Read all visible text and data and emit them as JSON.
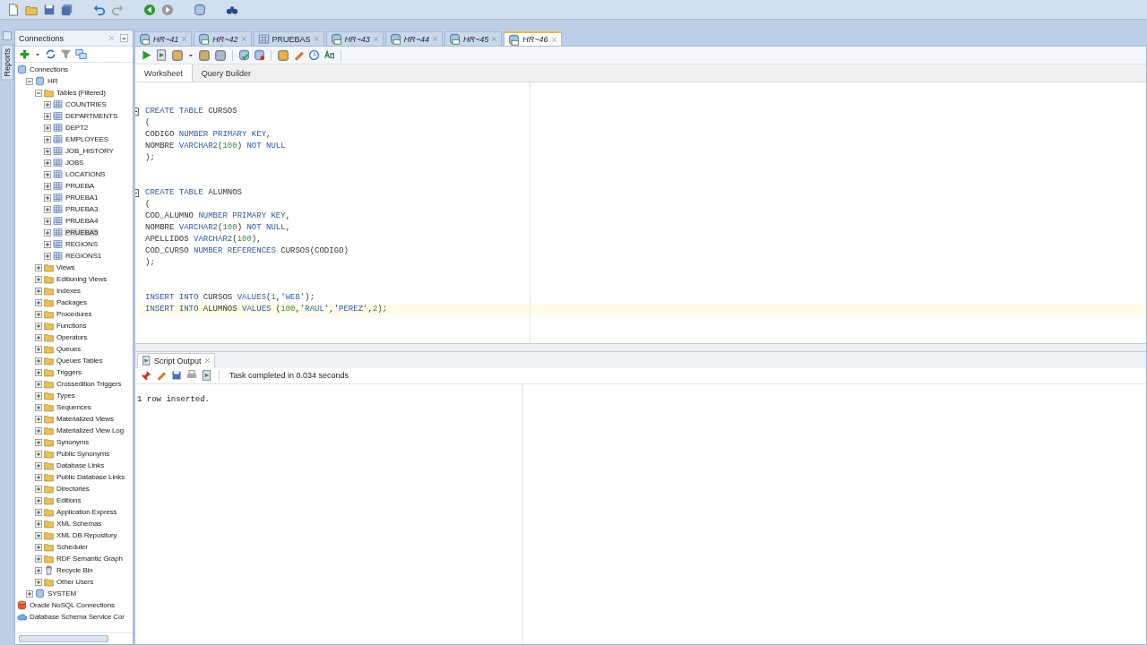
{
  "side_strip": {
    "label": "Reports"
  },
  "connections_panel": {
    "title": "Connections",
    "tree": [
      {
        "label": "Connections",
        "kind": "root",
        "selected": false,
        "children": [
          {
            "label": "HR",
            "kind": "connection",
            "expanded": true,
            "selected": false,
            "children": [
              {
                "label": "Tables (Filtered)",
                "kind": "folder",
                "expanded": true,
                "selected": false,
                "children": [
                  {
                    "label": "COUNTRIES",
                    "kind": "table",
                    "expanded": false,
                    "selected": false
                  },
                  {
                    "label": "DEPARTMENTS",
                    "kind": "table",
                    "expanded": false,
                    "selected": false
                  },
                  {
                    "label": "DEPT2",
                    "kind": "table",
                    "expanded": false,
                    "selected": false
                  },
                  {
                    "label": "EMPLOYEES",
                    "kind": "table",
                    "expanded": false,
                    "selected": false
                  },
                  {
                    "label": "JOB_HISTORY",
                    "kind": "table",
                    "expanded": false,
                    "selected": false
                  },
                  {
                    "label": "JOBS",
                    "kind": "table",
                    "expanded": false,
                    "selected": false
                  },
                  {
                    "label": "LOCATIONS",
                    "kind": "table",
                    "expanded": false,
                    "selected": false
                  },
                  {
                    "label": "PRUEBA",
                    "kind": "table",
                    "expanded": false,
                    "selected": false
                  },
                  {
                    "label": "PRUEBA1",
                    "kind": "table",
                    "expanded": false,
                    "selected": false
                  },
                  {
                    "label": "PRUEBA3",
                    "kind": "table",
                    "expanded": false,
                    "selected": false
                  },
                  {
                    "label": "PRUEBA4",
                    "kind": "table",
                    "expanded": false,
                    "selected": false
                  },
                  {
                    "label": "PRUEBA5",
                    "kind": "table",
                    "expanded": false,
                    "selected": true
                  },
                  {
                    "label": "REGIONS",
                    "kind": "table",
                    "expanded": false,
                    "selected": false
                  },
                  {
                    "label": "REGIONS1",
                    "kind": "table",
                    "expanded": false,
                    "selected": false
                  }
                ]
              },
              {
                "label": "Views",
                "kind": "folder",
                "expanded": false,
                "selected": false
              },
              {
                "label": "Editioning Views",
                "kind": "folder",
                "expanded": false,
                "selected": false
              },
              {
                "label": "Indexes",
                "kind": "folder",
                "expanded": false,
                "selected": false
              },
              {
                "label": "Packages",
                "kind": "folder",
                "expanded": false,
                "selected": false
              },
              {
                "label": "Procedures",
                "kind": "folder",
                "expanded": false,
                "selected": false
              },
              {
                "label": "Functions",
                "kind": "folder",
                "expanded": false,
                "selected": false
              },
              {
                "label": "Operators",
                "kind": "folder",
                "expanded": false,
                "selected": false
              },
              {
                "label": "Queues",
                "kind": "folder",
                "expanded": false,
                "selected": false
              },
              {
                "label": "Queues Tables",
                "kind": "folder",
                "expanded": false,
                "selected": false
              },
              {
                "label": "Triggers",
                "kind": "folder",
                "expanded": false,
                "selected": false
              },
              {
                "label": "Crossedition Triggers",
                "kind": "folder",
                "expanded": false,
                "selected": false
              },
              {
                "label": "Types",
                "kind": "folder",
                "expanded": false,
                "selected": false
              },
              {
                "label": "Sequences",
                "kind": "folder",
                "expanded": false,
                "selected": false
              },
              {
                "label": "Materialized Views",
                "kind": "folder",
                "expanded": false,
                "selected": false
              },
              {
                "label": "Materialized View Log",
                "kind": "folder",
                "expanded": false,
                "selected": false
              },
              {
                "label": "Synonyms",
                "kind": "folder",
                "expanded": false,
                "selected": false
              },
              {
                "label": "Public Synonyms",
                "kind": "folder",
                "expanded": false,
                "selected": false
              },
              {
                "label": "Database Links",
                "kind": "folder",
                "expanded": false,
                "selected": false
              },
              {
                "label": "Public Database Links",
                "kind": "folder",
                "expanded": false,
                "selected": false
              },
              {
                "label": "Directories",
                "kind": "folder",
                "expanded": false,
                "selected": false
              },
              {
                "label": "Editions",
                "kind": "folder",
                "expanded": false,
                "selected": false
              },
              {
                "label": "Application Express",
                "kind": "folder",
                "expanded": false,
                "selected": false
              },
              {
                "label": "XML Schemas",
                "kind": "folder",
                "expanded": false,
                "selected": false
              },
              {
                "label": "XML DB Repository",
                "kind": "folder",
                "expanded": false,
                "selected": false
              },
              {
                "label": "Scheduler",
                "kind": "folder",
                "expanded": false,
                "selected": false
              },
              {
                "label": "RDF Semantic Graph",
                "kind": "folder",
                "expanded": false,
                "selected": false
              },
              {
                "label": "Recycle Bin",
                "kind": "bin",
                "expanded": false,
                "selected": false
              },
              {
                "label": "Other Users",
                "kind": "folder",
                "expanded": false,
                "selected": false
              }
            ]
          },
          {
            "label": "SYSTEM",
            "kind": "connection",
            "expanded": false,
            "selected": false
          }
        ]
      },
      {
        "label": "Oracle NoSQL Connections",
        "kind": "nosql",
        "selected": false
      },
      {
        "label": "Database Schema Service Cor",
        "kind": "cloud",
        "selected": false
      }
    ]
  },
  "editor_tabs": [
    {
      "label": "HR~41",
      "kind": "worksheet",
      "selected": false
    },
    {
      "label": "HR~42",
      "kind": "worksheet",
      "selected": false
    },
    {
      "label": "PRUEBAS",
      "kind": "table",
      "selected": false
    },
    {
      "label": "HR~43",
      "kind": "worksheet",
      "selected": false
    },
    {
      "label": "HR~44",
      "kind": "worksheet",
      "selected": false
    },
    {
      "label": "HR~45",
      "kind": "worksheet",
      "selected": false
    },
    {
      "label": "HR~46",
      "kind": "worksheet",
      "selected": true
    }
  ],
  "sub_tabs": [
    {
      "label": "Worksheet",
      "selected": true
    },
    {
      "label": "Query Builder",
      "selected": false
    }
  ],
  "editor": {
    "lines": [
      {
        "kind": "code",
        "foldable": true,
        "current": false,
        "tokens": [
          {
            "text": "CREATE TABLE ",
            "kind": "keyword"
          },
          {
            "text": "CURSOS",
            "kind": "name"
          }
        ]
      },
      {
        "kind": "code",
        "foldable": false,
        "current": false,
        "tokens": [
          {
            "text": "(",
            "kind": "name"
          }
        ]
      },
      {
        "kind": "code",
        "foldable": false,
        "current": false,
        "tokens": [
          {
            "text": "CODIGO ",
            "kind": "name"
          },
          {
            "text": "NUMBER PRIMARY KEY",
            "kind": "keyword"
          },
          {
            "text": ",",
            "kind": "name"
          }
        ]
      },
      {
        "kind": "code",
        "foldable": false,
        "current": false,
        "tokens": [
          {
            "text": "NOMBRE ",
            "kind": "name"
          },
          {
            "text": "VARCHAR2",
            "kind": "keyword"
          },
          {
            "text": "(",
            "kind": "name"
          },
          {
            "text": "100",
            "kind": "number"
          },
          {
            "text": ") ",
            "kind": "name"
          },
          {
            "text": "NOT NULL",
            "kind": "keyword"
          }
        ]
      },
      {
        "kind": "code",
        "foldable": false,
        "current": false,
        "tokens": [
          {
            "text": ");",
            "kind": "name"
          }
        ]
      },
      {
        "kind": "blank"
      },
      {
        "kind": "blank"
      },
      {
        "kind": "code",
        "foldable": true,
        "current": false,
        "tokens": [
          {
            "text": "CREATE TABLE ",
            "kind": "keyword"
          },
          {
            "text": "ALUMNOS",
            "kind": "name"
          }
        ]
      },
      {
        "kind": "code",
        "foldable": false,
        "current": false,
        "tokens": [
          {
            "text": "(",
            "kind": "name"
          }
        ]
      },
      {
        "kind": "code",
        "foldable": false,
        "current": false,
        "tokens": [
          {
            "text": "COD_ALUMNO ",
            "kind": "name"
          },
          {
            "text": "NUMBER PRIMARY KEY",
            "kind": "keyword"
          },
          {
            "text": ",",
            "kind": "name"
          }
        ]
      },
      {
        "kind": "code",
        "foldable": false,
        "current": false,
        "tokens": [
          {
            "text": "NOMBRE ",
            "kind": "name"
          },
          {
            "text": "VARCHAR2",
            "kind": "keyword"
          },
          {
            "text": "(",
            "kind": "name"
          },
          {
            "text": "100",
            "kind": "number"
          },
          {
            "text": ") ",
            "kind": "name"
          },
          {
            "text": "NOT NULL",
            "kind": "keyword"
          },
          {
            "text": ",",
            "kind": "name"
          }
        ]
      },
      {
        "kind": "code",
        "foldable": false,
        "current": false,
        "tokens": [
          {
            "text": "APELLIDOS ",
            "kind": "name"
          },
          {
            "text": "VARCHAR2",
            "kind": "keyword"
          },
          {
            "text": "(",
            "kind": "name"
          },
          {
            "text": "100",
            "kind": "number"
          },
          {
            "text": "),",
            "kind": "name"
          }
        ]
      },
      {
        "kind": "code",
        "foldable": false,
        "current": false,
        "tokens": [
          {
            "text": "COD_CURSO ",
            "kind": "name"
          },
          {
            "text": "NUMBER REFERENCES ",
            "kind": "keyword"
          },
          {
            "text": "CURSOS(CODIGO)",
            "kind": "name"
          }
        ]
      },
      {
        "kind": "code",
        "foldable": false,
        "current": false,
        "tokens": [
          {
            "text": ");",
            "kind": "name"
          }
        ]
      },
      {
        "kind": "blank"
      },
      {
        "kind": "blank"
      },
      {
        "kind": "code",
        "foldable": false,
        "current": false,
        "tokens": [
          {
            "text": "INSERT INTO ",
            "kind": "keyword"
          },
          {
            "text": "CURSOS ",
            "kind": "name"
          },
          {
            "text": "VALUES",
            "kind": "keyword"
          },
          {
            "text": "(",
            "kind": "name"
          },
          {
            "text": "1",
            "kind": "number"
          },
          {
            "text": ",",
            "kind": "name"
          },
          {
            "text": "'WEB'",
            "kind": "string"
          },
          {
            "text": ");",
            "kind": "name"
          }
        ]
      },
      {
        "kind": "code",
        "foldable": false,
        "current": true,
        "tokens": [
          {
            "text": "INSERT INTO ",
            "kind": "keyword"
          },
          {
            "text": "ALUMNOS ",
            "kind": "name"
          },
          {
            "text": "VALUES ",
            "kind": "keyword"
          },
          {
            "text": "(",
            "kind": "name"
          },
          {
            "text": "100",
            "kind": "number"
          },
          {
            "text": ",",
            "kind": "name"
          },
          {
            "text": "'RAUL'",
            "kind": "string"
          },
          {
            "text": ",",
            "kind": "name"
          },
          {
            "text": "'PEREZ'",
            "kind": "string"
          },
          {
            "text": ",",
            "kind": "name"
          },
          {
            "text": "2",
            "kind": "number"
          },
          {
            "text": ");",
            "kind": "name"
          }
        ]
      }
    ]
  },
  "output": {
    "tab": {
      "label": "Script Output"
    },
    "status": "Task completed in 0.034 seconds",
    "lines": [
      "1 row inserted."
    ]
  }
}
